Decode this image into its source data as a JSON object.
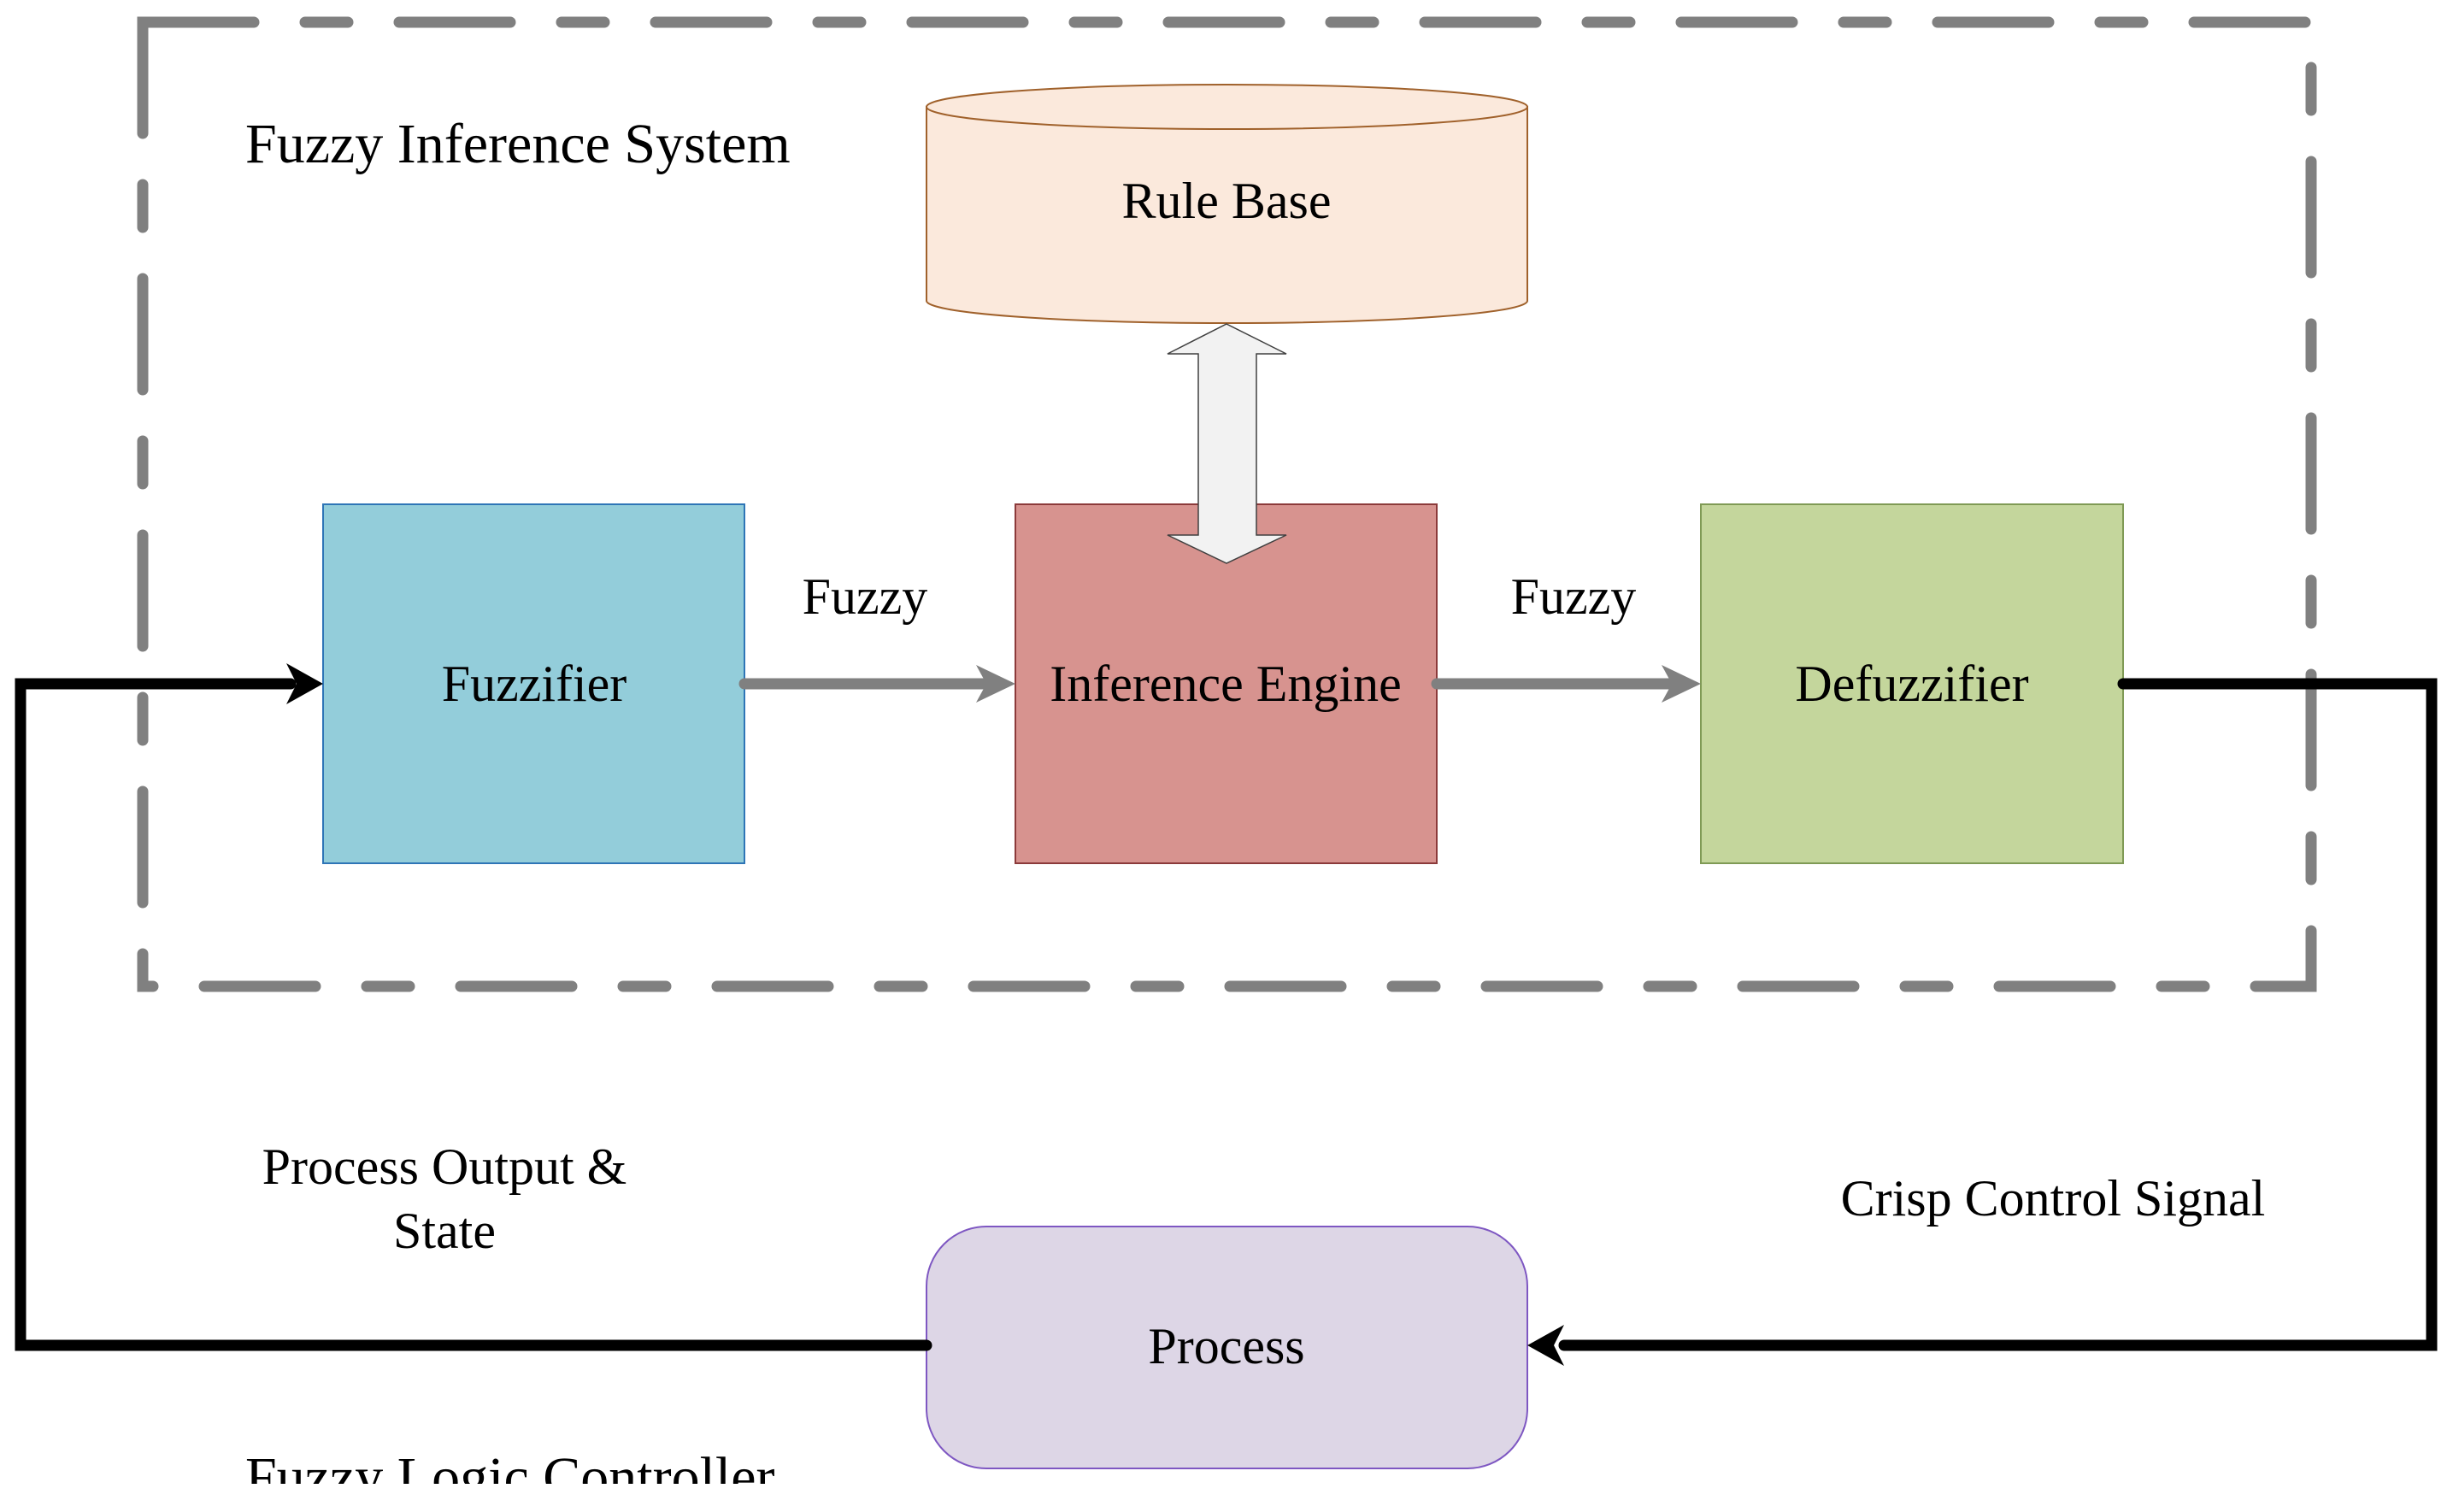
{
  "diagram": {
    "container_label": "Fuzzy Inference System",
    "outer_label": "Fuzzy Logic Controller",
    "nodes": {
      "rule_base": {
        "label": "Rule Base",
        "fill": "#FBE9DC",
        "stroke": "#A0612B"
      },
      "fuzzifier": {
        "label": "Fuzzifier",
        "fill": "#93CDDA",
        "stroke": "#2E75B6"
      },
      "inference_engine": {
        "label": "Inference Engine",
        "fill": "#D7938F",
        "stroke": "#8B3A3A"
      },
      "defuzzifier": {
        "label": "Defuzzifier",
        "fill": "#C4D69C",
        "stroke": "#7F9A55"
      },
      "process": {
        "label": "Process",
        "fill": "#DDD6E6",
        "stroke": "#7E57C2"
      }
    },
    "edges": {
      "fuzzifier_to_inference": {
        "label": "Fuzzy"
      },
      "inference_to_defuzzifier": {
        "label": "Fuzzy"
      },
      "defuzzifier_to_process": {
        "label": "Crisp Control Signal"
      },
      "process_to_fuzzifier": {
        "label_line1": "Process Output &",
        "label_line2": "State"
      }
    },
    "colors": {
      "dashed_border": "#808080",
      "internal_arrow": "#808080",
      "feedback_arrow": "#000000",
      "double_arrow_fill": "#F2F2F2"
    }
  }
}
